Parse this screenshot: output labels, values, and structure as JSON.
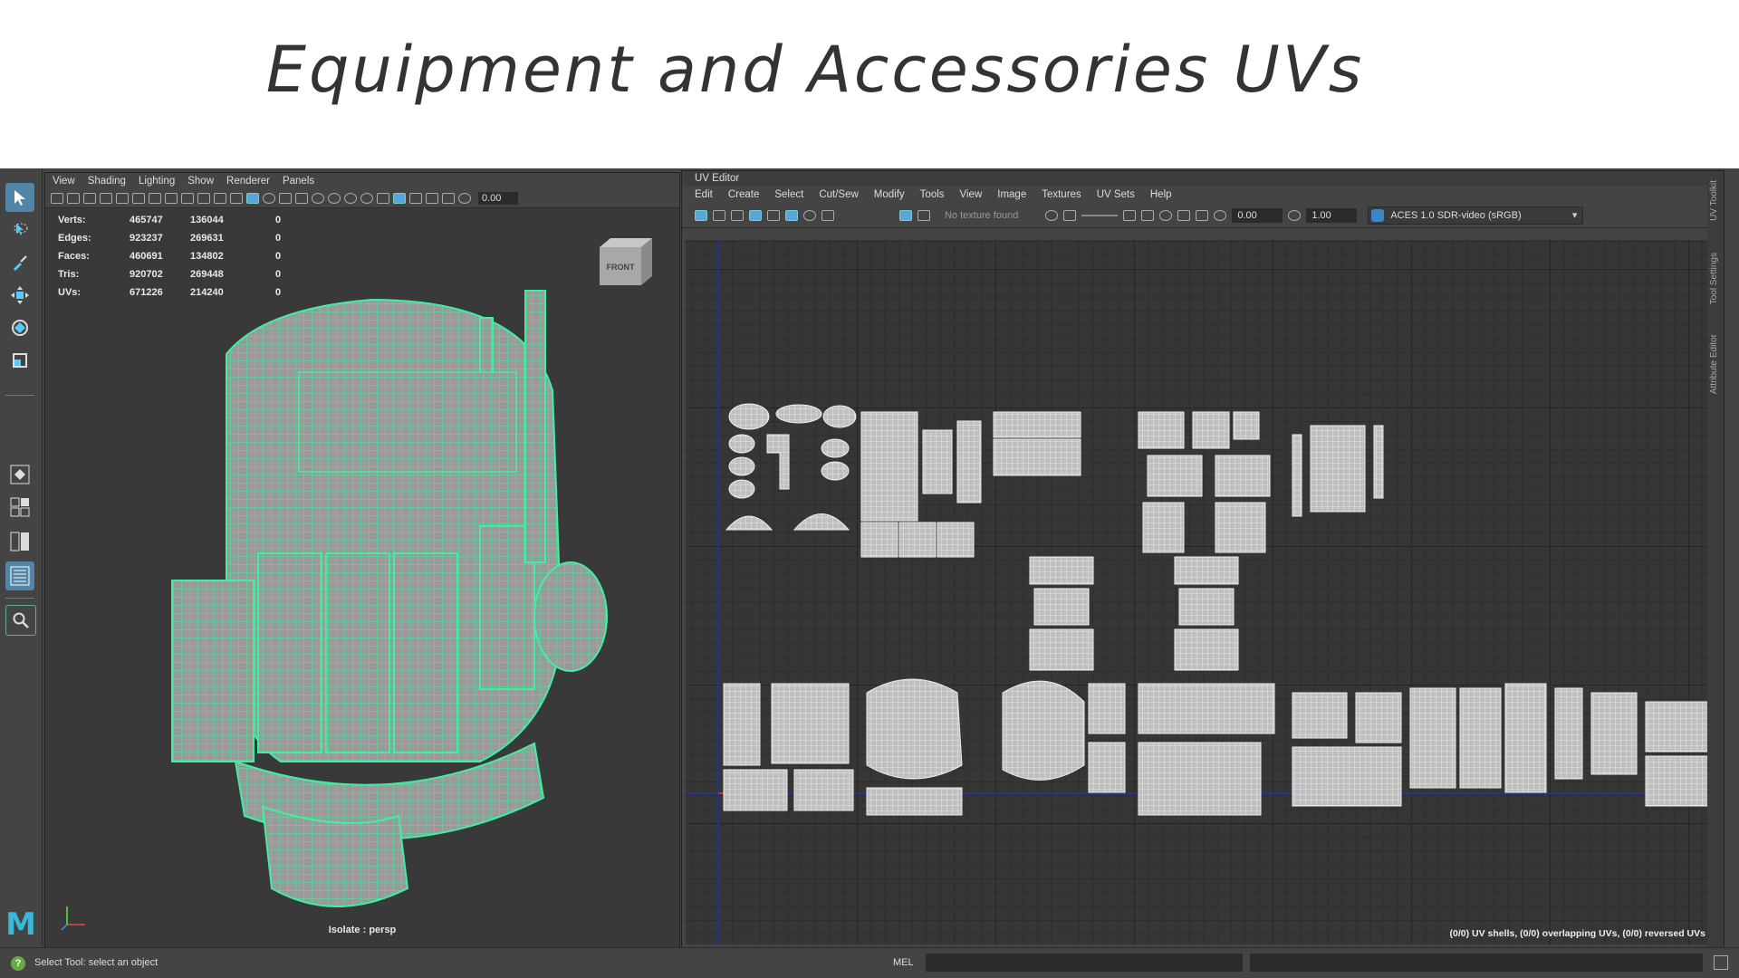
{
  "slide_title": "Equipment and Accessories UVs",
  "viewport": {
    "menu": [
      "View",
      "Shading",
      "Lighting",
      "Show",
      "Renderer",
      "Panels"
    ],
    "toolbar_value": "0.00",
    "stats": [
      {
        "label": "Verts:",
        "total": "465747",
        "selected": "136044",
        "extra": "0"
      },
      {
        "label": "Edges:",
        "total": "923237",
        "selected": "269631",
        "extra": "0"
      },
      {
        "label": "Faces:",
        "total": "460691",
        "selected": "134802",
        "extra": "0"
      },
      {
        "label": "Tris:",
        "total": "920702",
        "selected": "269448",
        "extra": "0"
      },
      {
        "label": "UVs:",
        "total": "671226",
        "selected": "214240",
        "extra": "0"
      }
    ],
    "view_cube_label": "FRONT",
    "isolate_label": "Isolate : persp",
    "wire_color": "#3ff0a0"
  },
  "uv_editor": {
    "title": "UV Editor",
    "menu": [
      "Edit",
      "Create",
      "Select",
      "Cut/Sew",
      "Modify",
      "Tools",
      "View",
      "Image",
      "Textures",
      "UV Sets",
      "Help"
    ],
    "texture_label": "No texture found",
    "exposure": "0.00",
    "gamma": "1.00",
    "color_space": "ACES 1.0 SDR-video (sRGB)",
    "status": "(0/0) UV shells, (0/0) overlapping UVs, (0/0) reversed UVs",
    "side_tabs": [
      "UV Toolkit",
      "Tool Settings",
      "Attribute Editor"
    ]
  },
  "toolbox": {
    "logo": "M",
    "icons": [
      "select-arrow-icon",
      "lasso-icon",
      "paint-icon",
      "move-icon",
      "rotate-icon",
      "scale-icon"
    ]
  },
  "bottom_bar": {
    "help_text": "Select Tool: select an object",
    "mel_label": "MEL"
  }
}
